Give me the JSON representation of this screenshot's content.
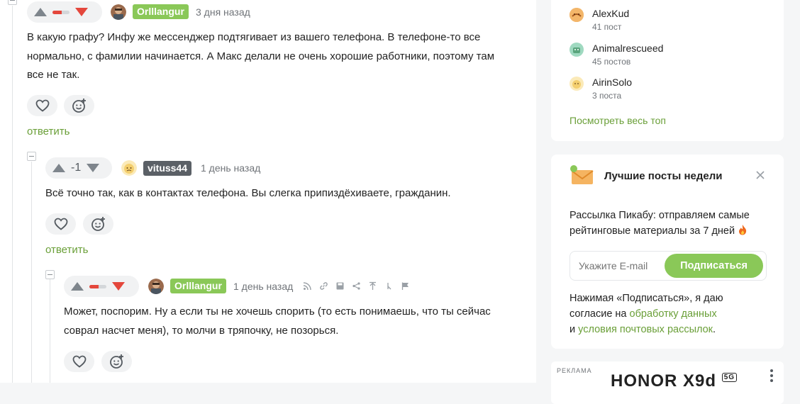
{
  "comments": [
    {
      "author": "Orlllangur",
      "time": "3 дня назад",
      "text_lines": [
        "В какую графу? Инфу же мессенджер подтягивает из вашего телефона. В телефоне-то все",
        "нормально, с фамилии начинается. А Макс делали не очень хорошие работники, поэтому там",
        "все не так."
      ],
      "rating_negative_fraction": 0.55,
      "reply_label": "ответить"
    },
    {
      "author": "vituss44",
      "time": "1 день назад",
      "rating": "-1",
      "text_lines": [
        "Всё точно так, как в контактах телефона. Вы слегка припиздёхиваете, гражданин."
      ],
      "reply_label": "ответить"
    },
    {
      "author": "Orlllangur",
      "time": "1 день назад",
      "text_lines": [
        "Может, поспорим. Ну а если ты не хочешь спорить (то есть понимаешь, что ты сейчас",
        "соврал насчет меня), то молчи в тряпочку, не позорься."
      ],
      "rating_negative_fraction": 0.55
    }
  ],
  "sidebar": {
    "top_users": [
      {
        "name": "AlexKud",
        "count": "41 пост"
      },
      {
        "name": "Animalrescueed",
        "count": "45 постов"
      },
      {
        "name": "AirinSolo",
        "count": "3 поста"
      }
    ],
    "see_all_link": "Посмотреть весь топ",
    "newsletter": {
      "title": "Лучшие посты недели",
      "desc_line1": "Рассылка Пикабу: отправляем самые",
      "desc_line2": "рейтинговые материалы за 7 дней",
      "email_placeholder": "Укажите E-mail",
      "subscribe_label": "Подписаться",
      "consent_line1": "Нажимая «Подписаться», я даю",
      "consent_line2_prefix": "согласие на",
      "consent_link1": "обработку данных",
      "consent_line3_prefix": "и",
      "consent_link2": "условия почтовых рассылок",
      "consent_suffix": "."
    },
    "ad": {
      "label": "РЕКЛАМА",
      "brand_text": "HONOR X9d",
      "brand_badge": "5G"
    }
  },
  "colors": {
    "accent_green": "#8ac858",
    "link_green": "#6a9f38",
    "downvote_red": "#e4473c"
  }
}
